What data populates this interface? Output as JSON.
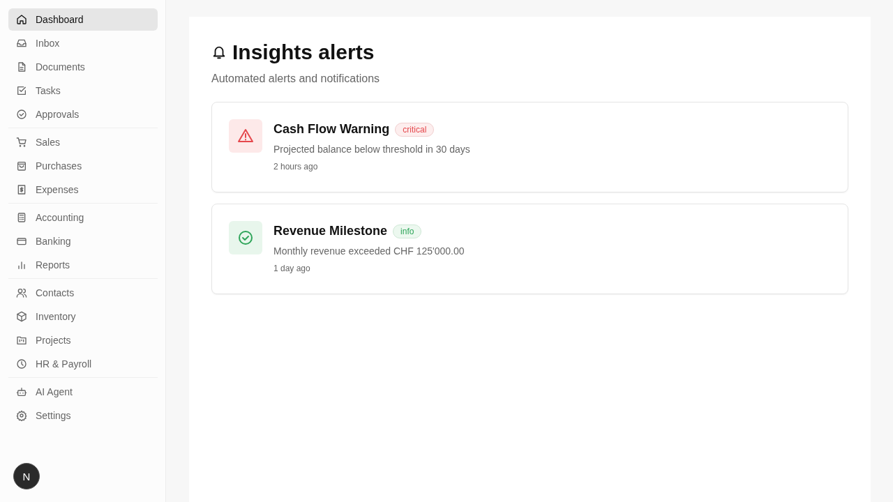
{
  "sidebar": {
    "groups": [
      {
        "items": [
          {
            "label": "Dashboard",
            "selected": true
          },
          {
            "label": "Inbox",
            "selected": false
          },
          {
            "label": "Documents",
            "selected": false
          },
          {
            "label": "Tasks",
            "selected": false
          },
          {
            "label": "Approvals",
            "selected": false
          }
        ]
      },
      {
        "items": [
          {
            "label": "Sales",
            "selected": false
          },
          {
            "label": "Purchases",
            "selected": false
          },
          {
            "label": "Expenses",
            "selected": false
          }
        ]
      },
      {
        "items": [
          {
            "label": "Accounting",
            "selected": false
          },
          {
            "label": "Banking",
            "selected": false
          },
          {
            "label": "Reports",
            "selected": false
          }
        ]
      },
      {
        "items": [
          {
            "label": "Contacts",
            "selected": false
          },
          {
            "label": "Inventory",
            "selected": false
          },
          {
            "label": "Projects",
            "selected": false
          },
          {
            "label": "HR & Payroll",
            "selected": false
          }
        ]
      },
      {
        "items": [
          {
            "label": "AI Agent",
            "selected": false
          },
          {
            "label": "Settings",
            "selected": false
          }
        ]
      }
    ],
    "avatar": "N"
  },
  "page": {
    "title": "Insights alerts",
    "subtitle": "Automated alerts and notifications"
  },
  "alerts": [
    {
      "kind": "warning",
      "title": "Cash Flow Warning",
      "badge": "critical",
      "message": "Projected balance below threshold in 30 days",
      "time": "2 hours ago"
    },
    {
      "kind": "success",
      "title": "Revenue Milestone",
      "badge": "info",
      "message": "Monthly revenue exceeded CHF 125'000.00",
      "time": "1 day ago"
    }
  ]
}
